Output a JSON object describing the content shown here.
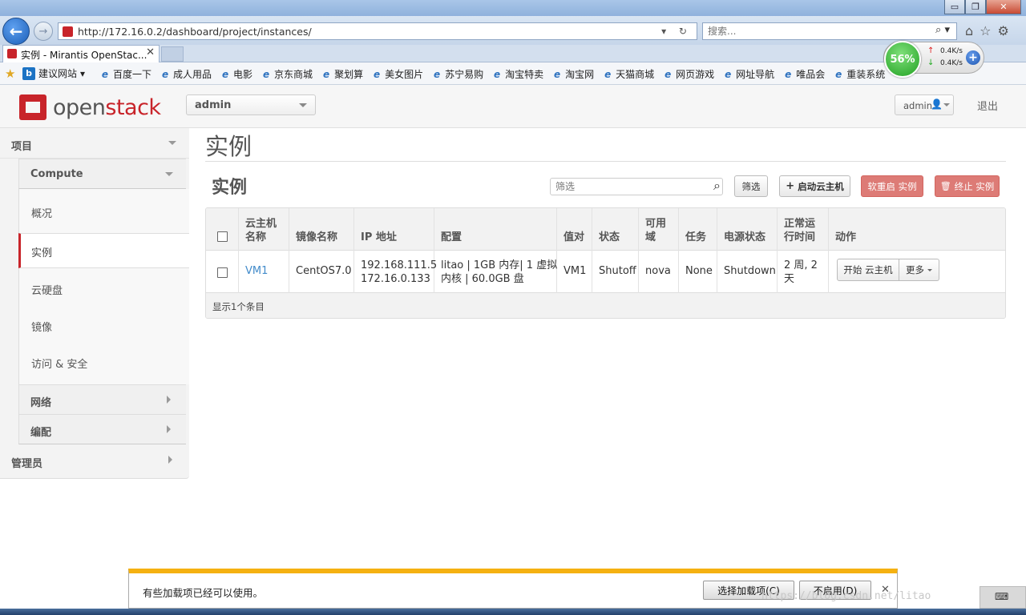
{
  "browser": {
    "window_controls": {
      "minimize": "▭",
      "maximize": "❐",
      "close": "✕"
    },
    "url": "http://172.16.0.2/dashboard/project/instances/",
    "url_controls": "▾ ↻",
    "search_placeholder": "搜索...",
    "search_icon": "search-icon",
    "tab_title": "实例 - Mirantis OpenStac...",
    "tab_close": "✕",
    "favorites": {
      "first": "建议网站",
      "items": [
        "百度一下",
        "成人用品",
        "电影",
        "京东商城",
        "聚划算",
        "美女图片",
        "苏宁易购",
        "淘宝特卖",
        "淘宝网",
        "天猫商城",
        "网页游戏",
        "网址导航",
        "唯品会",
        "重装系统"
      ]
    },
    "speed": {
      "percent": "56%",
      "up": "0.4K/s",
      "down": "0.4K/s"
    }
  },
  "app": {
    "logo_open": "open",
    "logo_stack": "stack",
    "project_selector": "admin",
    "user_menu": "admin",
    "logout": "退出"
  },
  "sidebar": {
    "project": "项目",
    "compute": "Compute",
    "items": [
      "概况",
      "实例",
      "云硬盘",
      "镜像",
      "访问 & 安全"
    ],
    "active_index": 1,
    "network": "网络",
    "orchestration": "编配",
    "admin": "管理员"
  },
  "main": {
    "page_title": "实例",
    "section_title": "实例",
    "filter_placeholder": "筛选",
    "filter_button": "筛选",
    "launch_button": "启动云主机",
    "soft_reboot_button": "软重启 实例",
    "terminate_button": "终止 实例",
    "table": {
      "headers": [
        "云主机名称",
        "镜像名称",
        "IP 地址",
        "配置",
        "值对",
        "状态",
        "可用域",
        "任务",
        "电源状态",
        "正常运行时间",
        "动作"
      ],
      "header_lines": {
        "name": [
          "云主机",
          "名称"
        ],
        "az": [
          "可用",
          "域"
        ],
        "uptime": [
          "正常运",
          "行时间"
        ]
      },
      "rows": [
        {
          "name": "VM1",
          "image": "CentOS7.0",
          "ip": [
            "192.168.111.5",
            "172.16.0.133"
          ],
          "flavor": [
            "litao | 1GB 内存| 1 虚拟",
            "内核 | 60.0GB 盘"
          ],
          "keypair": "VM1",
          "status": "Shutoff",
          "availability_zone": "nova",
          "task": "None",
          "power_state": "Shutdown",
          "uptime": [
            "2 周, 2",
            "天"
          ],
          "action_primary": "开始 云主机",
          "action_more": "更多"
        }
      ],
      "footer": "显示1个条目"
    }
  },
  "notification": {
    "text": "有些加载项已经可以使用。",
    "choose_addons": "选择加载项(C)",
    "disable": "不启用(D)",
    "close": "✕"
  },
  "watermark": "https://blog.csdn.net/litao",
  "tray_icon": "⌨"
}
